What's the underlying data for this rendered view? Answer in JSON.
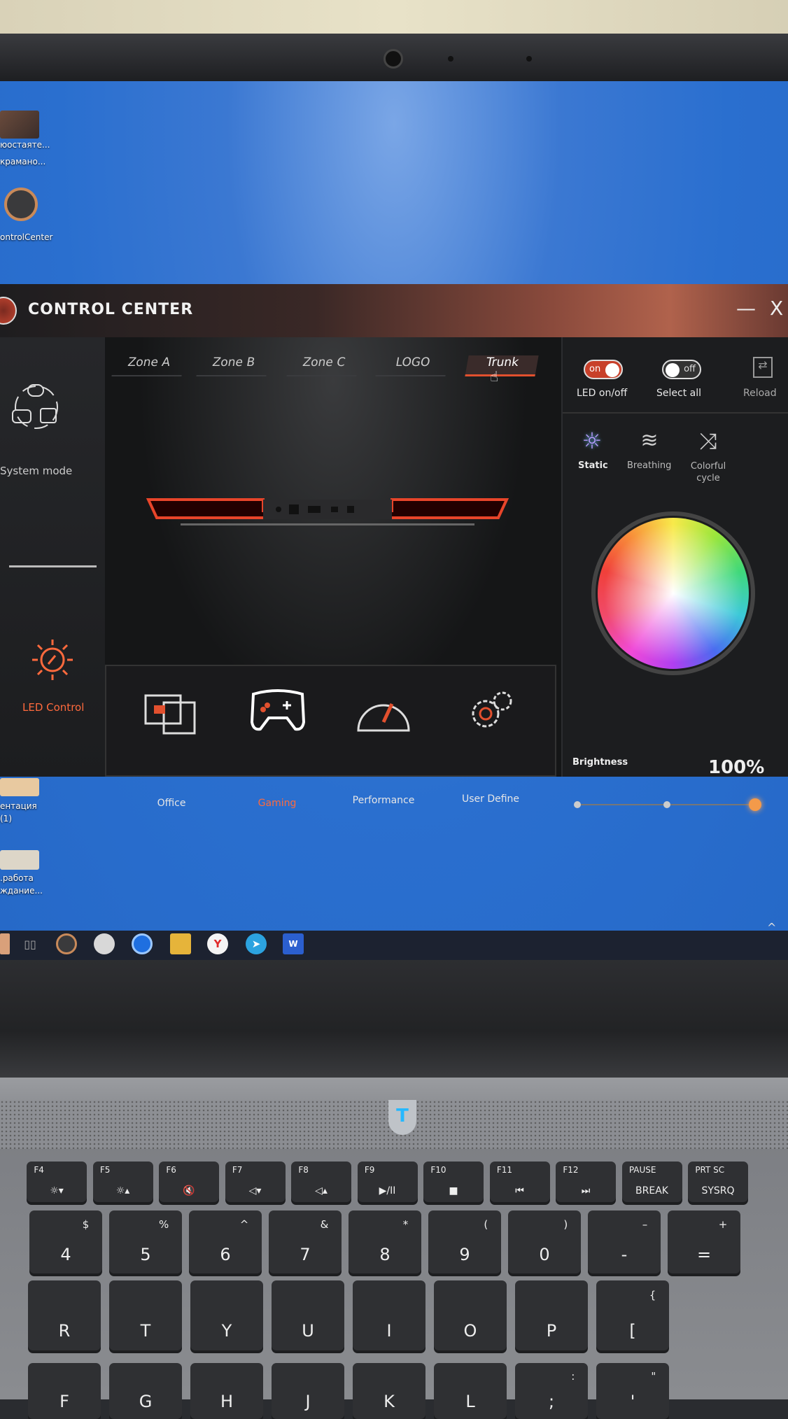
{
  "desktop": {
    "icons": [
      {
        "line1": "юостаяте...",
        "line2": "крамано..."
      },
      {
        "line1": "ontrolCenter",
        "line2": ""
      },
      {
        "line1": "ентация",
        "line2": "(1)"
      },
      {
        "line1": ".работа",
        "line2": "ждание..."
      }
    ]
  },
  "taskbar": {
    "icons": [
      "photo-thumbnail-icon",
      "task-view-icon",
      "control-center-icon",
      "app-icon",
      "edge-icon",
      "folder-icon",
      "yandex-browser-icon",
      "telegram-icon",
      "word-icon"
    ],
    "word_letter": "W",
    "yandex_letter": "Y",
    "tray_chevron": "^"
  },
  "app": {
    "title": "CONTROL CENTER",
    "minimize": "—",
    "close": "X",
    "sidebar": [
      {
        "label": "System mode",
        "active": false
      },
      {
        "label": "LED Control",
        "active": true
      }
    ],
    "tabs": [
      {
        "label": "Zone A",
        "active": false
      },
      {
        "label": "Zone B",
        "active": false
      },
      {
        "label": "Zone C",
        "active": false
      },
      {
        "label": "LOGO",
        "active": false
      },
      {
        "label": "Trunk",
        "active": true
      }
    ],
    "controls": {
      "led_toggle": {
        "state": "on",
        "label": "LED on/off"
      },
      "select_all": {
        "state": "off",
        "label": "Select all"
      },
      "reload_label": "Reload"
    },
    "effects": [
      {
        "label": "Static",
        "active": true
      },
      {
        "label": "Breathing",
        "active": false
      },
      {
        "label": "Colorful cycle",
        "active": false
      }
    ],
    "brightness": {
      "label": "Brightness",
      "value_text": "100%",
      "value": 100
    },
    "modes": [
      {
        "label": "Office",
        "active": false
      },
      {
        "label": "Gaming",
        "active": true
      },
      {
        "label": "Performance",
        "active": false
      },
      {
        "label": "User Define",
        "active": false
      }
    ],
    "colors": {
      "accent": "#e2502e",
      "active_text": "#ff6a3d",
      "led": "#e8452a"
    }
  },
  "keyboard": {
    "rows": [
      [
        {
          "f": "F4",
          "m": "☼▾"
        },
        {
          "f": "F5",
          "m": "☼▴"
        },
        {
          "f": "F6",
          "m": "🔇"
        },
        {
          "f": "F7",
          "m": "◁▾"
        },
        {
          "f": "F8",
          "m": "◁▴"
        },
        {
          "f": "F9",
          "m": "▶/II"
        },
        {
          "f": "F10",
          "m": "■"
        },
        {
          "f": "F11",
          "m": "⏮"
        },
        {
          "f": "F12",
          "m": "⏭"
        },
        {
          "f": "PAUSE",
          "m": "BREAK"
        },
        {
          "f": "PRT SC",
          "m": "SYSRQ"
        }
      ],
      [
        {
          "s": "$",
          "m": "4"
        },
        {
          "s": "%",
          "m": "5"
        },
        {
          "s": "^",
          "m": "6"
        },
        {
          "s": "&",
          "m": "7"
        },
        {
          "s": "*",
          "m": "8"
        },
        {
          "s": "(",
          "m": "9"
        },
        {
          "s": ")",
          "m": "0"
        },
        {
          "s": "–",
          "m": "-"
        },
        {
          "s": "+",
          "m": "="
        }
      ],
      [
        {
          "m": "R"
        },
        {
          "m": "T"
        },
        {
          "m": "Y"
        },
        {
          "m": "U"
        },
        {
          "m": "I"
        },
        {
          "m": "O"
        },
        {
          "m": "P"
        },
        {
          "s": "{",
          "m": "["
        }
      ],
      [
        {
          "m": "F"
        },
        {
          "m": "G"
        },
        {
          "m": "H"
        },
        {
          "m": "J"
        },
        {
          "m": "K"
        },
        {
          "m": "L"
        },
        {
          "s": ":",
          "m": ";"
        },
        {
          "s": "\"",
          "m": "'"
        }
      ]
    ],
    "logo_letter": "T"
  }
}
